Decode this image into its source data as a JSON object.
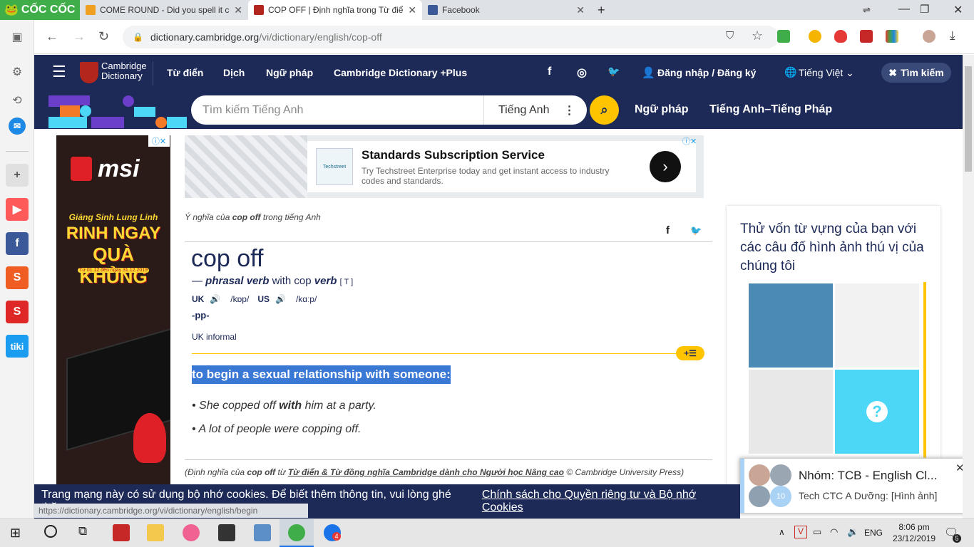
{
  "browser": {
    "brand": "CỐC CỐC",
    "tabs": [
      {
        "title": "COME ROUND - Did you spell it co",
        "active": false
      },
      {
        "title": "COP OFF | Định nghĩa trong Từ điể",
        "active": true
      },
      {
        "title": "Facebook",
        "active": false
      }
    ],
    "new_tab": "+",
    "url_domain": "dictionary.cambridge.org",
    "url_path": "/vi/dictionary/english/cop-off",
    "status_url": "https://dictionary.cambridge.org/vi/dictionary/english/begin"
  },
  "site": {
    "logo_line1": "Cambridge",
    "logo_line2": "Dictionary",
    "nav": [
      "Từ điển",
      "Dịch",
      "Ngữ pháp",
      "Cambridge Dictionary +Plus"
    ],
    "social": {
      "facebook": "f",
      "instagram": "◎",
      "twitter": "🐦"
    },
    "login": "Đăng nhập / Đăng ký",
    "language": "Tiếng Việt",
    "search_button": "Tìm kiếm",
    "search_placeholder": "Tìm kiếm Tiếng Anh",
    "search_dict": "Tiếng Anh",
    "links2": [
      "Ngữ pháp",
      "Tiếng Anh–Tiếng Pháp"
    ]
  },
  "ad_top": {
    "title": "Standards Subscription Service",
    "body": "Try Techstreet Enterprise today and get instant access to industry codes and standards.",
    "logo_text": "Techstreet"
  },
  "ad_left": {
    "brand": "msi",
    "promo_line1": "Giáng Sinh Lung Linh",
    "promo_line2": "RINH NGAY",
    "promo_line3": "QUÀ KHỦNG",
    "promo_dates": "Từ 01.12 đến ngày 31.12.2019"
  },
  "entry": {
    "meaning_prefix": "Ý nghĩa của",
    "meaning_word": "cop off",
    "meaning_suffix": "trong tiếng Anh",
    "headword": "cop off",
    "dash": "—",
    "pos": "phrasal verb",
    "with": "with cop",
    "verb": "verb",
    "grammar": "[ T ]",
    "uk_label": "UK",
    "uk_ipa": "/kɒp/",
    "us_label": "US",
    "us_ipa": "/kɑːp/",
    "inflection": "-pp-",
    "register": "UK informal",
    "definition": "to begin a sexual relationship with someone:",
    "examples": [
      {
        "pre": "She copped off ",
        "bold": "with",
        "post": " him at a party."
      },
      {
        "pre": "A lot of people were copping off.",
        "bold": "",
        "post": ""
      }
    ],
    "credit_prefix": "(Định nghĩa của",
    "credit_word": "cop off",
    "credit_from": "từ",
    "credit_link": "Từ điển & Từ đồng nghĩa Cambridge dành cho Người học Nâng cao",
    "credit_suffix": "© Cambridge University Press)"
  },
  "quiz": {
    "title": "Thử vốn từ vựng của bạn với các câu đố hình ảnh thú vị của chúng tôi",
    "unknown": "?"
  },
  "chat": {
    "title": "Nhóm: TCB - English Cl...",
    "message": "Tech CTC A Dưỡng: [Hình ảnh]",
    "count": "10"
  },
  "cookie": {
    "text": "Trang mạng này có sử dụng bộ nhớ cookies. Để biết thêm thông tin, vui lòng ghé thăm",
    "link": "Chính sách cho Quyền riêng tư và Bộ nhớ Cookies"
  },
  "taskbar": {
    "lang": "ENG",
    "time": "8:06 pm",
    "date": "23/12/2019",
    "zalo_badge": "4",
    "notif_count": "5"
  },
  "colors": {
    "navy": "#1d2a57",
    "yellow": "#fec400",
    "highlight": "#3a78d6",
    "coccoc_green": "#3fae49"
  }
}
